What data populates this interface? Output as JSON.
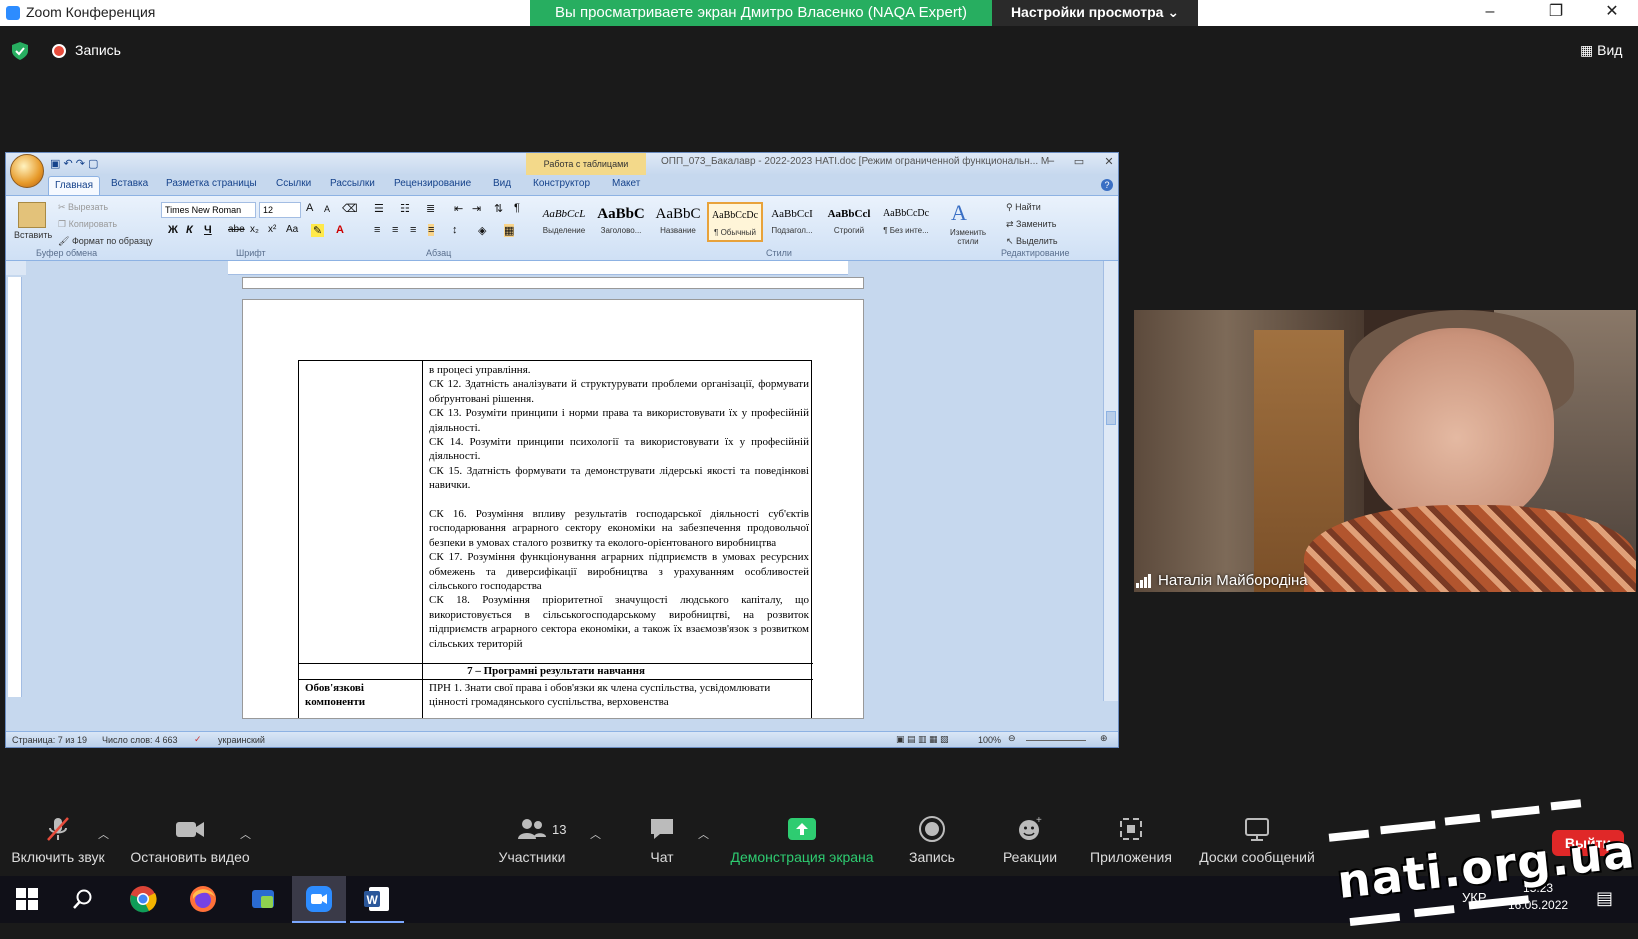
{
  "titlebar": {
    "app_title": "Zoom Конференция",
    "share_banner": "Вы просматриваете экран Дмитро Власенко (NAQA Expert)",
    "view_settings": "Настройки просмотра",
    "minimize": "–",
    "maximize": "❐",
    "close": "✕"
  },
  "top_bar": {
    "record_label": "Запись",
    "view_label": "Вид"
  },
  "word": {
    "tables_context": "Работа с таблицами",
    "doc_title": "ОПП_073_Бакалавр - 2022-2023 НАТІ.doc [Режим ограниченной функциональн... М",
    "tabs": [
      "Главная",
      "Вставка",
      "Разметка страницы",
      "Ссылки",
      "Рассылки",
      "Рецензирование",
      "Вид",
      "Конструктор",
      "Макет"
    ],
    "clipboard": {
      "paste": "Вставить",
      "cut": "Вырезать",
      "copy": "Копировать",
      "format_painter": "Формат по образцу",
      "group": "Буфер обмена"
    },
    "font": {
      "name": "Times New Roman",
      "size": "12",
      "group": "Шрифт",
      "bold": "Ж",
      "italic": "К",
      "underline": "Ч",
      "strike": "abe",
      "sub": "x₂",
      "sup": "x²",
      "case": "Aa",
      "grow": "A",
      "shrink": "A"
    },
    "paragraph_group": "Абзац",
    "styles": [
      {
        "sample": "AaBbCcL",
        "name": "Выделение"
      },
      {
        "sample": "AaBbC",
        "name": "Заголово..."
      },
      {
        "sample": "AaBbC",
        "name": "Название"
      },
      {
        "sample": "AaBbCcDc",
        "name": "¶ Обычный"
      },
      {
        "sample": "AaBbCcI",
        "name": "Подзагол..."
      },
      {
        "sample": "AaBbCcl",
        "name": "Строгий"
      },
      {
        "sample": "AaBbCcDc",
        "name": "¶ Без инте..."
      }
    ],
    "styles_group": "Стили",
    "change_styles": "Изменить стили",
    "editing": {
      "find": "Найти",
      "replace": "Заменить",
      "select": "Выделить",
      "group": "Редактирование"
    },
    "document": {
      "paragraphs": [
        "в процесі управління.",
        "СК 12. Здатність аналізувати й структурувати проблеми організації, формувати обґрунтовані рішення.",
        "СК 13. Розуміти принципи і норми права та використовувати їх у професійній діяльності.",
        "СК 14. Розуміти принципи психології та використовувати їх у професійній діяльності.",
        "СК 15. Здатність формувати та демонструвати лідерські якості та поведінкові навички.",
        "",
        "СК 16. Розуміння впливу результатів господарської діяльності суб'єктів господарювання аграрного сектору економіки на забезпечення продовольчої безпеки в умовах сталого розвитку та еколого-орієнтованого виробництва",
        "СК 17. Розуміння функціонування аграрних підприємств в умовах ресурсних обмежень та диверсифікації виробництва з урахуванням особливостей сільського господарства",
        "СК 18. Розуміння пріоритетної значущості людського капіталу, що використовується в сільськогосподарському виробництві, на розвиток підприємств аграрного сектора економіки, а також їх взаємозв'язок з розвитком сільських територій"
      ],
      "results_heading": "7 – Програмні результати навчання",
      "mandatory_label": "Обов'язкові компоненти",
      "prn1": "ПРН 1. Знати свої права і обов'язки як члена суспільства, усвідомлювати цінності громадянського суспільства, верховенства"
    },
    "status": {
      "page": "Страница: 7 из 19",
      "words": "Число слов: 4 663",
      "language": "украинский",
      "zoom": "100%"
    }
  },
  "participant": {
    "name": "Наталія Майбородіна"
  },
  "toolbar": {
    "unmute": "Включить звук",
    "stop_video": "Остановить видео",
    "participants": "Участники",
    "participants_count": "13",
    "chat": "Чат",
    "share_screen": "Демонстрация экрана",
    "record": "Запись",
    "reactions": "Реакции",
    "apps": "Приложения",
    "whiteboards": "Доски сообщений",
    "leave": "Выйти"
  },
  "taskbar": {
    "lang": "УКР",
    "time": "15:23",
    "date": "16.05.2022"
  },
  "watermark": {
    "text": "nati.org.ua"
  },
  "colors": {
    "share_banner": "#27ae60",
    "leave": "#e02828",
    "share_label": "#2ecc71"
  }
}
